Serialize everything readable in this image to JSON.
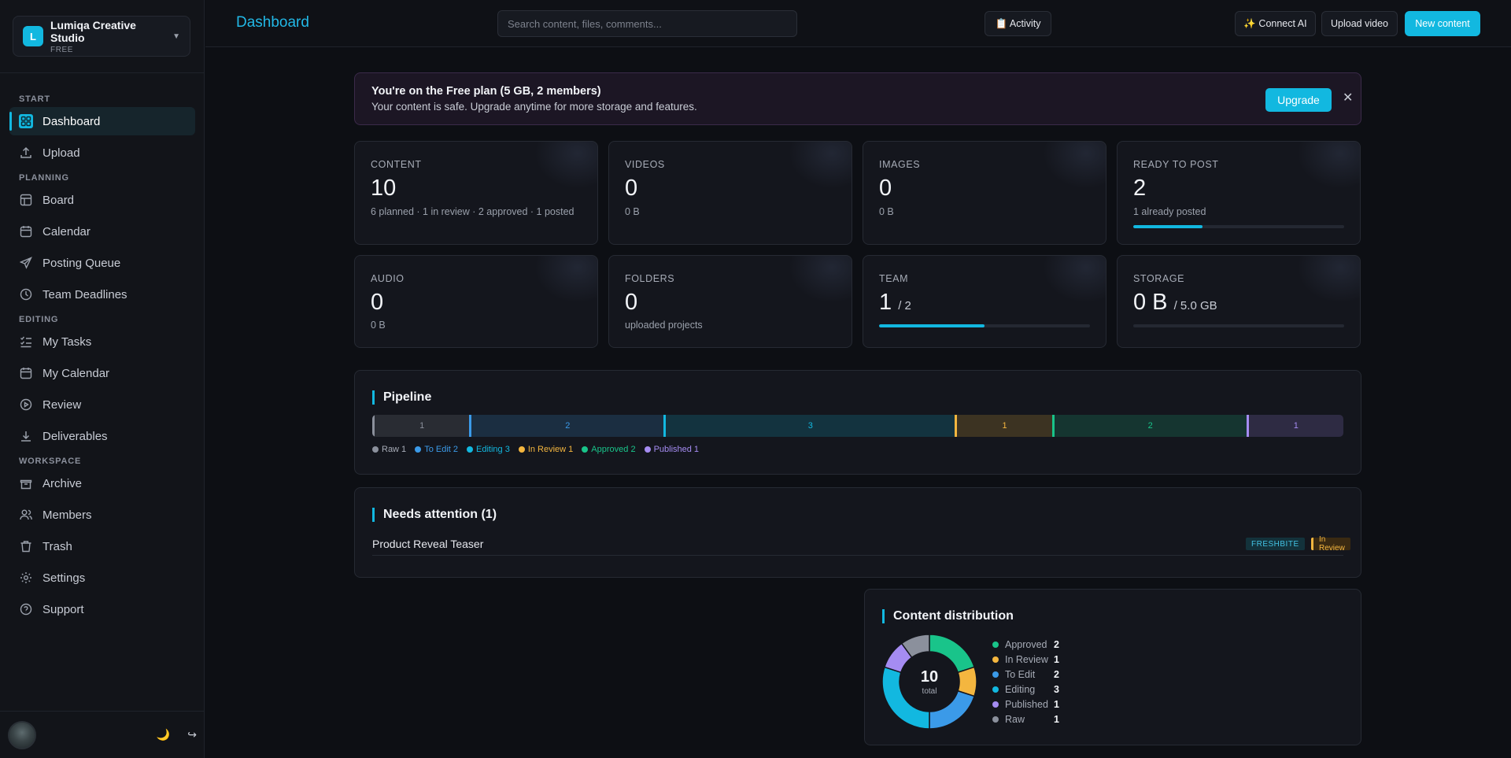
{
  "workspace": {
    "initial": "L",
    "name": "Lumiqa Creative Studio",
    "plan": "FREE"
  },
  "sidebar": {
    "sections": [
      {
        "title": "START",
        "items": [
          {
            "label": "Dashboard",
            "icon": "dashboard-icon",
            "active": true
          },
          {
            "label": "Upload",
            "icon": "upload-icon"
          }
        ]
      },
      {
        "title": "PLANNING",
        "items": [
          {
            "label": "Board",
            "icon": "board-icon"
          },
          {
            "label": "Calendar",
            "icon": "calendar-icon"
          },
          {
            "label": "Posting Queue",
            "icon": "send-icon"
          },
          {
            "label": "Team Deadlines",
            "icon": "clock-icon"
          }
        ]
      },
      {
        "title": "EDITING",
        "items": [
          {
            "label": "My Tasks",
            "icon": "tasks-icon"
          },
          {
            "label": "My Calendar",
            "icon": "calendar-icon"
          },
          {
            "label": "Review",
            "icon": "play-circle-icon"
          },
          {
            "label": "Deliverables",
            "icon": "download-icon"
          }
        ]
      },
      {
        "title": "WORKSPACE",
        "items": [
          {
            "label": "Archive",
            "icon": "archive-icon"
          },
          {
            "label": "Members",
            "icon": "members-icon"
          },
          {
            "label": "Trash",
            "icon": "trash-icon"
          },
          {
            "label": "Settings",
            "icon": "gear-icon"
          },
          {
            "label": "Support",
            "icon": "help-icon"
          }
        ]
      }
    ]
  },
  "header": {
    "title": "Dashboard",
    "search_placeholder": "Search content, files, comments...",
    "activity_label": "📋 Activity",
    "connect_ai_label": "✨ Connect AI",
    "upload_video_label": "Upload video",
    "new_content_label": "New content"
  },
  "banner": {
    "title": "You're on the Free plan (5 GB, 2 members)",
    "text": "Your content is safe. Upgrade anytime for more storage and features.",
    "upgrade_label": "Upgrade",
    "close": "✕"
  },
  "stats": {
    "content": {
      "label": "CONTENT",
      "value": "10",
      "note": "6 planned · 1 in review · 2 approved · 1 posted"
    },
    "videos": {
      "label": "VIDEOS",
      "value": "0",
      "note": "0 B"
    },
    "images": {
      "label": "IMAGES",
      "value": "0",
      "note": "0 B"
    },
    "ready": {
      "label": "READY TO POST",
      "value": "2",
      "note": "1 already posted",
      "progress": 0.33
    },
    "audio": {
      "label": "AUDIO",
      "value": "0",
      "note": "0 B"
    },
    "folders": {
      "label": "FOLDERS",
      "value": "0",
      "note": "uploaded projects"
    },
    "team": {
      "label": "TEAM",
      "value": "1",
      "sub": "/ 2",
      "progress": 0.5
    },
    "storage": {
      "label": "STORAGE",
      "value": "0 B",
      "sub": "/ 5.0 GB",
      "progress": 0
    }
  },
  "pipeline": {
    "title": "Pipeline",
    "stages": [
      {
        "name": "Raw",
        "count": 1,
        "color": "#8b909c"
      },
      {
        "name": "To Edit",
        "count": 2,
        "color": "#3b9ae8"
      },
      {
        "name": "Editing",
        "count": 3,
        "color": "#12b8e0"
      },
      {
        "name": "In Review",
        "count": 1,
        "color": "#f4b63f"
      },
      {
        "name": "Approved",
        "count": 2,
        "color": "#19c48a"
      },
      {
        "name": "Published",
        "count": 1,
        "color": "#a58cf2"
      }
    ]
  },
  "attention": {
    "title": "Needs attention (1)",
    "items": [
      {
        "name": "Product Reveal Teaser",
        "client": "FRESHBITE",
        "status": "In Review"
      }
    ]
  },
  "distribution": {
    "title": "Content distribution",
    "total": "10",
    "total_label": "total",
    "colors": {
      "approved": "#19c48a",
      "in_review": "#f4b63f",
      "to_edit": "#3b9ae8",
      "editing": "#12b8e0",
      "published": "#a58cf2",
      "raw": "#8b909c"
    }
  },
  "chart_data": {
    "type": "pie",
    "categories": [
      "Approved",
      "In Review",
      "To Edit",
      "Editing",
      "Published",
      "Raw"
    ],
    "values": [
      2,
      1,
      2,
      3,
      1,
      1
    ]
  }
}
